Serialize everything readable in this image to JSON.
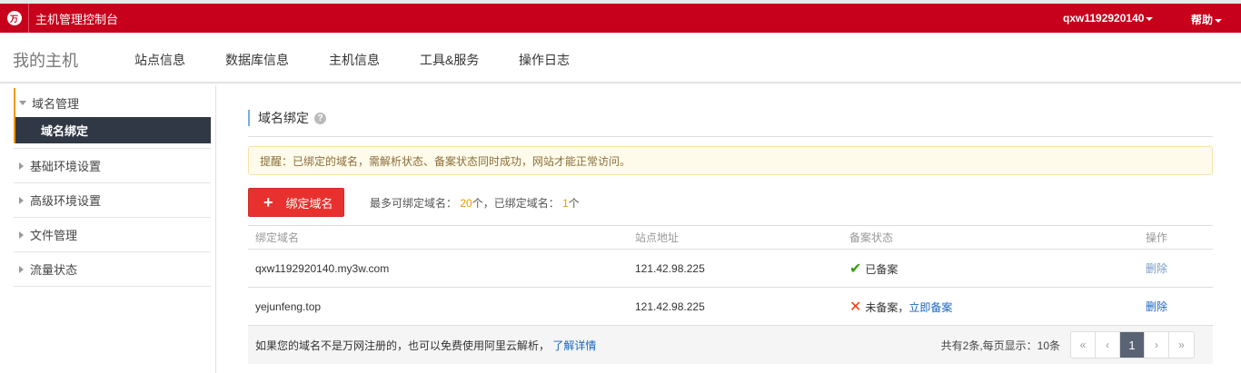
{
  "header": {
    "logo": "万",
    "title": "主机管理控制台",
    "user": "qxw1192920140",
    "help": "帮助"
  },
  "nav": {
    "brand": "我的主机",
    "items": [
      "站点信息",
      "数据库信息",
      "主机信息",
      "工具&服务",
      "操作日志"
    ]
  },
  "sidebar": {
    "group_open": "域名管理",
    "sub_active": "域名绑定",
    "groups": [
      "基础环境设置",
      "高级环境设置",
      "文件管理",
      "流量状态"
    ]
  },
  "main": {
    "title": "域名绑定",
    "help_icon": "?",
    "tip": "提醒：已绑定的域名，需解析状态、备案状态同时成功，网站才能正常访问。",
    "add_button": "绑定域名",
    "quota": {
      "max_label": "最多可绑定域名：",
      "max": "20",
      "unit1": "个，已绑定域名：",
      "bound": "1",
      "unit2": "个"
    },
    "columns": [
      "绑定域名",
      "站点地址",
      "备案状态",
      "操作"
    ],
    "rows": [
      {
        "domain": "qxw1192920140.my3w.com",
        "ip": "121.42.98.225",
        "status": "已备案",
        "status_link": "",
        "action": "删除"
      },
      {
        "domain": "yejunfeng.top",
        "ip": "121.42.98.225",
        "status": "未备案，",
        "status_link": "立即备案",
        "action": "删除"
      }
    ],
    "footer": {
      "text": "如果您的域名不是万网注册的，也可以免费使用阿里云解析，",
      "link": "了解详情",
      "total": "共有2条,每页显示：10条"
    },
    "pager": {
      "first": "«",
      "prev": "‹",
      "current": "1",
      "next": "›",
      "last": "»"
    }
  }
}
